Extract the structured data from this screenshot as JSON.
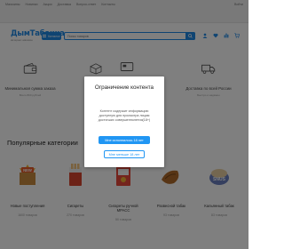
{
  "topbar": {
    "nav": [
      "Магазины",
      "Новинки",
      "Акции",
      "Доставка",
      "Вопрос-ответ",
      "Контакты"
    ],
    "contact": "Войти"
  },
  "header": {
    "logo": "ДымТабакка",
    "logo_sub": "интернет-магазин",
    "catalog_label": "Каталог",
    "search_placeholder": "Поиск товаров"
  },
  "features": [
    {
      "title": "Минимальная сумма заказа",
      "desc": "Всего 800 рублей",
      "icon": "wallet-icon"
    },
    {
      "title": "",
      "desc": "",
      "icon": "box-icon"
    },
    {
      "title": "",
      "desc": "",
      "icon": "card-icon"
    },
    {
      "title": "Доставка по всей России",
      "desc": "Быстро и надёжно",
      "icon": "truck-icon"
    }
  ],
  "section": {
    "title": "Популярные категории"
  },
  "categories": [
    {
      "name": "Новые поступления",
      "count": "1600 товаров",
      "icon": "new-badge-icon"
    },
    {
      "name": "Сигареты",
      "count": "270 товаров",
      "icon": "cigarettes-icon"
    },
    {
      "name": "Сигареты ручной MPACC",
      "count": "50 товаров",
      "icon": "cigarette-pack-icon"
    },
    {
      "name": "Развесной табак",
      "count": "93 товаров",
      "icon": "tobacco-icon"
    },
    {
      "name": "Кальянный табак",
      "count": "83 товаров",
      "icon": "hookah-tobacco-icon"
    }
  ],
  "modal": {
    "title": "Ограничение контента",
    "text": "Контент содержит информацию доступную для просмотра лицам достигших совершеннолетия(18+)",
    "adult_button": "Мне исполнилось 18 лет",
    "minor_button": "Мне меньше 18 лет"
  },
  "colors": {
    "accent": "#2196f3",
    "brand": "#1e88e5",
    "overlay": "rgba(0,0,0,0.5)"
  }
}
